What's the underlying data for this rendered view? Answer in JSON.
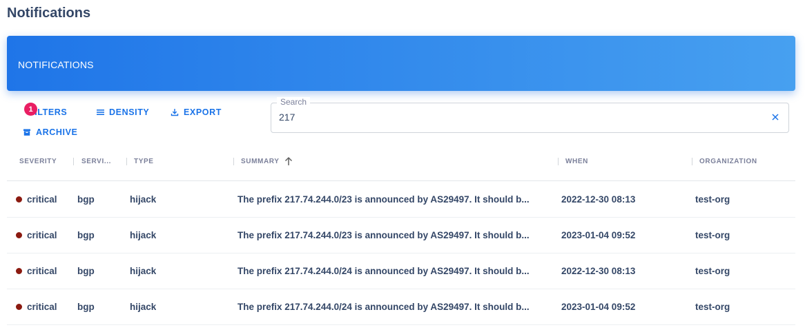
{
  "page": {
    "title": "Notifications"
  },
  "card": {
    "header_title": "NOTIFICATIONS"
  },
  "toolbar": {
    "filters_label": "FILTERS",
    "filters_badge": "1",
    "density_label": "DENSITY",
    "export_label": "EXPORT",
    "archive_label": "ARCHIVE"
  },
  "search": {
    "label": "Search",
    "value": "217"
  },
  "table": {
    "columns": {
      "severity": "SEVERITY",
      "service": "SERVI...",
      "type": "TYPE",
      "summary": "SUMMARY",
      "when": "WHEN",
      "organization": "ORGANIZATION"
    },
    "sort": {
      "column": "summary",
      "direction": "ascending"
    },
    "rows": [
      {
        "severity": "critical",
        "service": "bgp",
        "type": "hijack",
        "summary": "The prefix 217.74.244.0/23 is announced by AS29497. It should b...",
        "when": "2022-12-30 08:13",
        "organization": "test-org"
      },
      {
        "severity": "critical",
        "service": "bgp",
        "type": "hijack",
        "summary": "The prefix 217.74.244.0/23 is announced by AS29497. It should b...",
        "when": "2023-01-04 09:52",
        "organization": "test-org"
      },
      {
        "severity": "critical",
        "service": "bgp",
        "type": "hijack",
        "summary": "The prefix 217.74.244.0/24 is announced by AS29497. It should b...",
        "when": "2022-12-30 08:13",
        "organization": "test-org"
      },
      {
        "severity": "critical",
        "service": "bgp",
        "type": "hijack",
        "summary": "The prefix 217.74.244.0/24 is announced by AS29497. It should b...",
        "when": "2023-01-04 09:52",
        "organization": "test-org"
      }
    ]
  },
  "colors": {
    "header_gradient_start": "#1f75e8",
    "header_gradient_end": "#47a0f0",
    "accent": "#1a73e8",
    "badge": "#e91e63",
    "critical_dot": "#8b1a10"
  },
  "icons": {
    "filters": "filter-icon",
    "density": "density-lines-icon",
    "export": "download-icon",
    "archive": "archive-box-icon",
    "clear": "close-icon",
    "sort": "arrow-up-icon"
  }
}
